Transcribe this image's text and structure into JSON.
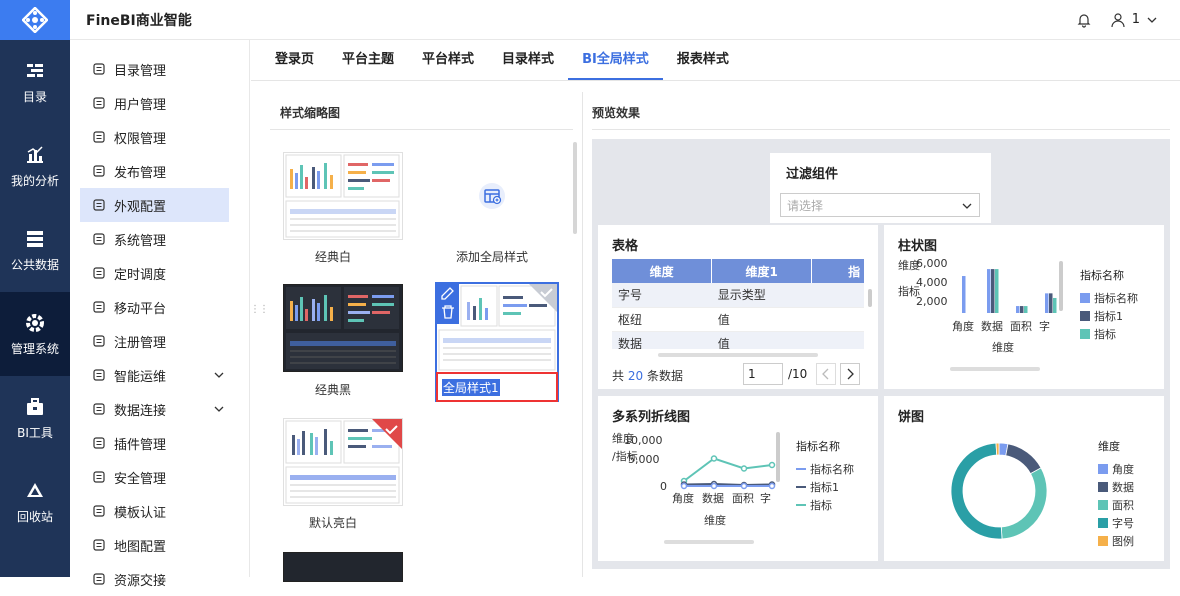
{
  "app": {
    "brand": "FineBI商业智能",
    "user": "1"
  },
  "rail": [
    {
      "label": "目录",
      "icon": "catalog-icon"
    },
    {
      "label": "我的分析",
      "icon": "analysis-icon"
    },
    {
      "label": "公共数据",
      "icon": "public-data-icon"
    },
    {
      "label": "管理系统",
      "icon": "gear-icon",
      "active": true
    },
    {
      "label": "BI工具",
      "icon": "toolbox-icon"
    },
    {
      "label": "回收站",
      "icon": "recycle-icon"
    }
  ],
  "menu": [
    {
      "label": "目录管理",
      "icon": "list-icon"
    },
    {
      "label": "用户管理",
      "icon": "user-icon"
    },
    {
      "label": "权限管理",
      "icon": "shield-icon"
    },
    {
      "label": "发布管理",
      "icon": "publish-icon"
    },
    {
      "label": "外观配置",
      "icon": "appearance-icon",
      "active": true
    },
    {
      "label": "系统管理",
      "icon": "settings-icon"
    },
    {
      "label": "定时调度",
      "icon": "timer-icon"
    },
    {
      "label": "移动平台",
      "icon": "mobile-icon"
    },
    {
      "label": "注册管理",
      "icon": "register-icon"
    },
    {
      "label": "智能运维",
      "icon": "ops-icon",
      "expandable": true
    },
    {
      "label": "数据连接",
      "icon": "link-icon",
      "expandable": true
    },
    {
      "label": "插件管理",
      "icon": "plugin-icon"
    },
    {
      "label": "安全管理",
      "icon": "security-icon"
    },
    {
      "label": "模板认证",
      "icon": "template-icon"
    },
    {
      "label": "地图配置",
      "icon": "map-icon"
    },
    {
      "label": "资源交接",
      "icon": "handover-icon"
    }
  ],
  "tabs": [
    {
      "label": "登录页"
    },
    {
      "label": "平台主题"
    },
    {
      "label": "平台样式"
    },
    {
      "label": "目录样式"
    },
    {
      "label": "BI全局样式",
      "active": true
    },
    {
      "label": "报表样式"
    }
  ],
  "thumbs": {
    "title": "样式缩略图",
    "items": {
      "classic_white": "经典白",
      "add": "添加全局样式",
      "classic_black": "经典黑",
      "custom": "全局样式1",
      "default": "默认亮白"
    }
  },
  "preview": {
    "title": "预览效果",
    "filter": {
      "title": "过滤组件",
      "placeholder": "请选择"
    },
    "table": {
      "title": "表格",
      "headers": [
        "维度",
        "维度1",
        "指"
      ],
      "rows": [
        [
          "字号",
          "显示类型"
        ],
        [
          "枢纽",
          "值"
        ],
        [
          "数据",
          "值"
        ]
      ],
      "footer": {
        "prefix": "共",
        "count": "20",
        "suffix": "条数据",
        "page": "1",
        "total": "/10"
      }
    },
    "bar": {
      "title": "柱状图",
      "ylabel": "维度 指标",
      "yticks": [
        "6,000",
        "4,000",
        "2,000"
      ],
      "categories": [
        "角度",
        "数据",
        "面积",
        "字"
      ],
      "xlabel": "维度",
      "legend_title": "指标名称",
      "legend": [
        "指标名称",
        "指标1",
        "指标"
      ]
    },
    "line": {
      "title": "多系列折线图",
      "ylabel": "维度/指标",
      "yticks": [
        "10,000",
        "5,000",
        "0"
      ],
      "categories": [
        "角度",
        "数据",
        "面积",
        "字"
      ],
      "xlabel": "维度",
      "legend_title": "指标名称",
      "legend": [
        "指标名称",
        "指标1",
        "指标"
      ]
    },
    "pie": {
      "title": "饼图",
      "legend_title": "维度",
      "legend": [
        "角度",
        "数据",
        "面积",
        "字号",
        "图例"
      ]
    }
  },
  "colors": {
    "accent": "#3c6fe0",
    "rail": "#1f3458",
    "blue": "#7b9cef",
    "slate": "#4a5a7a",
    "teal": "#5ec4b6",
    "teal_dark": "#2a9fa6",
    "orange": "#f5b04a"
  },
  "chart_data": [
    {
      "type": "bar",
      "categories": [
        "角度",
        "数据",
        "面积",
        "字"
      ],
      "series": [
        {
          "name": "指标名称",
          "values": [
            5200,
            5800,
            2600,
            3700
          ]
        },
        {
          "name": "指标1",
          "values": [
            0,
            5800,
            2600,
            3700
          ]
        },
        {
          "name": "指标",
          "values": [
            0,
            5800,
            2600,
            3300
          ]
        }
      ],
      "ylim": [
        2000,
        6500
      ]
    },
    {
      "type": "line",
      "categories": [
        "角度",
        "数据",
        "面积",
        "字"
      ],
      "series": [
        {
          "name": "指标名称",
          "values": [
            1000,
            5500,
            3500,
            4200
          ]
        },
        {
          "name": "指标1",
          "values": [
            300,
            400,
            200,
            300
          ]
        },
        {
          "name": "指标",
          "values": [
            0,
            0,
            0,
            0
          ]
        }
      ],
      "ylim": [
        0,
        10000
      ]
    },
    {
      "type": "pie",
      "categories": [
        "角度",
        "数据",
        "面积",
        "字号",
        "图例"
      ],
      "values": [
        3,
        14,
        32,
        50,
        1
      ]
    }
  ]
}
